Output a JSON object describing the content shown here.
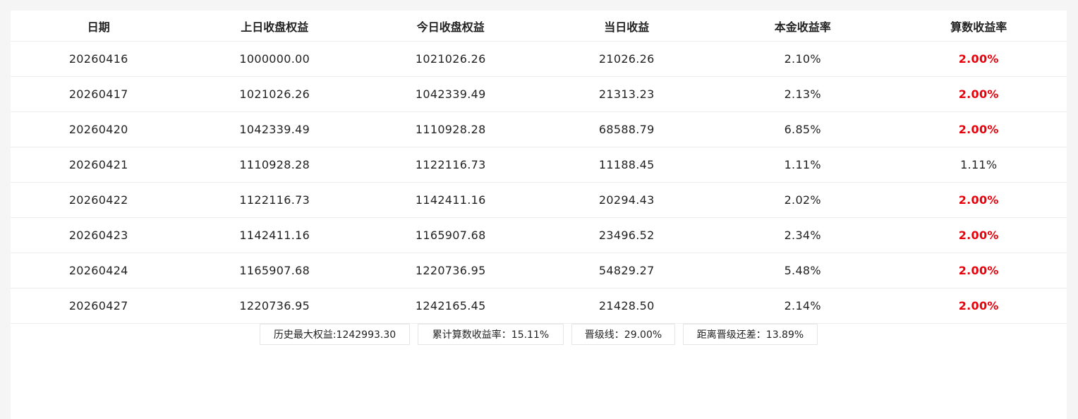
{
  "table": {
    "headers": [
      "日期",
      "上日收盘权益",
      "今日收盘权益",
      "当日收益",
      "本金收益率",
      "算数收益率"
    ],
    "rows": [
      {
        "date": "20260416",
        "prev_equity": "1000000.00",
        "today_equity": "1021026.26",
        "daily_profit": "21026.26",
        "principal_rate": "2.10%",
        "arith_rate": "2.00%",
        "arith_highlight": true
      },
      {
        "date": "20260417",
        "prev_equity": "1021026.26",
        "today_equity": "1042339.49",
        "daily_profit": "21313.23",
        "principal_rate": "2.13%",
        "arith_rate": "2.00%",
        "arith_highlight": true
      },
      {
        "date": "20260420",
        "prev_equity": "1042339.49",
        "today_equity": "1110928.28",
        "daily_profit": "68588.79",
        "principal_rate": "6.85%",
        "arith_rate": "2.00%",
        "arith_highlight": true
      },
      {
        "date": "20260421",
        "prev_equity": "1110928.28",
        "today_equity": "1122116.73",
        "daily_profit": "11188.45",
        "principal_rate": "1.11%",
        "arith_rate": "1.11%",
        "arith_highlight": false
      },
      {
        "date": "20260422",
        "prev_equity": "1122116.73",
        "today_equity": "1142411.16",
        "daily_profit": "20294.43",
        "principal_rate": "2.02%",
        "arith_rate": "2.00%",
        "arith_highlight": true
      },
      {
        "date": "20260423",
        "prev_equity": "1142411.16",
        "today_equity": "1165907.68",
        "daily_profit": "23496.52",
        "principal_rate": "2.34%",
        "arith_rate": "2.00%",
        "arith_highlight": true
      },
      {
        "date": "20260424",
        "prev_equity": "1165907.68",
        "today_equity": "1220736.95",
        "daily_profit": "54829.27",
        "principal_rate": "5.48%",
        "arith_rate": "2.00%",
        "arith_highlight": true
      },
      {
        "date": "20260427",
        "prev_equity": "1220736.95",
        "today_equity": "1242165.45",
        "daily_profit": "21428.50",
        "principal_rate": "2.14%",
        "arith_rate": "2.00%",
        "arith_highlight": true
      }
    ]
  },
  "summary": {
    "max_equity": "历史最大权益:1242993.30",
    "cumulative_rate": "累计算数收益率：15.11%",
    "upgrade_line": "晋级线：29.00%",
    "upgrade_gap": "距离晋级还差：13.89%"
  },
  "colors": {
    "highlight_red": "#e8000b"
  }
}
